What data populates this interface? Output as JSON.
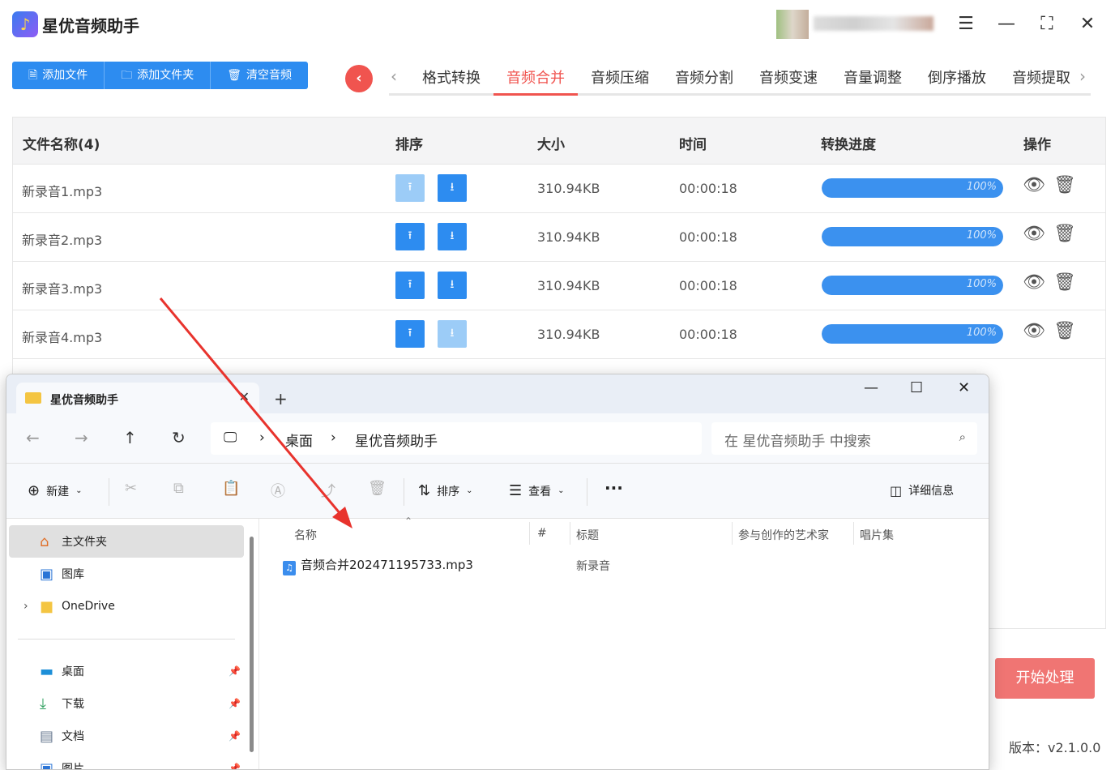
{
  "app": {
    "title": "星优音频助手",
    "logo_icon": "music-note",
    "toolbar": [
      {
        "label": "添加文件",
        "icon": "file-icon"
      },
      {
        "label": "添加文件夹",
        "icon": "folder-icon"
      },
      {
        "label": "清空音频",
        "icon": "trash-icon"
      }
    ],
    "tabs": [
      "格式转换",
      "音频合并",
      "音频压缩",
      "音频分割",
      "音频变速",
      "音量调整",
      "倒序播放",
      "音频提取"
    ],
    "active_tab": "音频合并",
    "table": {
      "headers": {
        "name": "文件名称(4)",
        "sort": "排序",
        "size": "大小",
        "time": "时间",
        "progress": "转换进度",
        "ops": "操作"
      },
      "rows": [
        {
          "name": "新录音1.mp3",
          "size": "310.94KB",
          "time": "00:00:18",
          "progress": 1.0,
          "progress_label": "100%",
          "up_disabled": true,
          "down_disabled": false
        },
        {
          "name": "新录音2.mp3",
          "size": "310.94KB",
          "time": "00:00:18",
          "progress": 1.0,
          "progress_label": "100%",
          "up_disabled": false,
          "down_disabled": false
        },
        {
          "name": "新录音3.mp3",
          "size": "310.94KB",
          "time": "00:00:18",
          "progress": 1.0,
          "progress_label": "100%",
          "up_disabled": false,
          "down_disabled": false
        },
        {
          "name": "新录音4.mp3",
          "size": "310.94KB",
          "time": "00:00:18",
          "progress": 1.0,
          "progress_label": "100%",
          "up_disabled": false,
          "down_disabled": true
        }
      ]
    },
    "start_button": "开始处理",
    "version": "版本：v2.1.0.0",
    "colors": {
      "primary": "#2d8cf0",
      "accent": "#f0544f",
      "start": "#f07573"
    }
  },
  "explorer": {
    "tab_title": "星优音频助手",
    "breadcrumb": [
      "桌面",
      "星优音频助手"
    ],
    "search_placeholder": "在 星优音频助手 中搜索",
    "commands": {
      "new": "新建",
      "sort": "排序",
      "view": "查看",
      "more": "···",
      "details": "详细信息"
    },
    "sidebar": [
      {
        "label": "主文件夹",
        "icon": "home-icon"
      },
      {
        "label": "图库",
        "icon": "gallery-icon"
      },
      {
        "label": "OneDrive",
        "icon": "folder-icon"
      },
      {
        "label": "桌面",
        "icon": "desktop-icon"
      },
      {
        "label": "下载",
        "icon": "download-icon"
      },
      {
        "label": "文档",
        "icon": "document-icon"
      },
      {
        "label": "图片",
        "icon": "picture-icon"
      }
    ],
    "columns": [
      "名称",
      "#",
      "标题",
      "参与创作的艺术家",
      "唱片集"
    ],
    "files": [
      {
        "name": "音频合并202471195733.mp3",
        "title": "新录音"
      }
    ]
  }
}
